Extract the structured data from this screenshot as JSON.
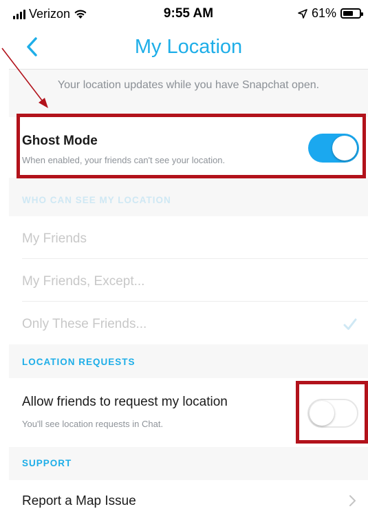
{
  "status_bar": {
    "carrier": "Verizon",
    "time": "9:55 AM",
    "battery_percent": "61%"
  },
  "nav": {
    "title": "My Location"
  },
  "info_note": "Your location updates while you have Snapchat open.",
  "ghost_mode": {
    "title": "Ghost Mode",
    "subtitle": "When enabled, your friends can't see your location.",
    "enabled": true
  },
  "who_can_see": {
    "header": "WHO CAN SEE MY LOCATION",
    "options": [
      {
        "label": "My Friends",
        "selected": false
      },
      {
        "label": "My Friends, Except...",
        "selected": false
      },
      {
        "label": "Only These Friends...",
        "selected": true
      }
    ]
  },
  "location_requests": {
    "header": "LOCATION REQUESTS",
    "title": "Allow friends to request my location",
    "subtitle": "You'll see location requests in Chat.",
    "enabled": false
  },
  "support": {
    "header": "SUPPORT",
    "items": [
      {
        "label": "Report a Map Issue"
      }
    ]
  },
  "colors": {
    "accent": "#1eaee8",
    "toggle_on": "#1ba8ef",
    "annotation_red": "#b2121b"
  }
}
